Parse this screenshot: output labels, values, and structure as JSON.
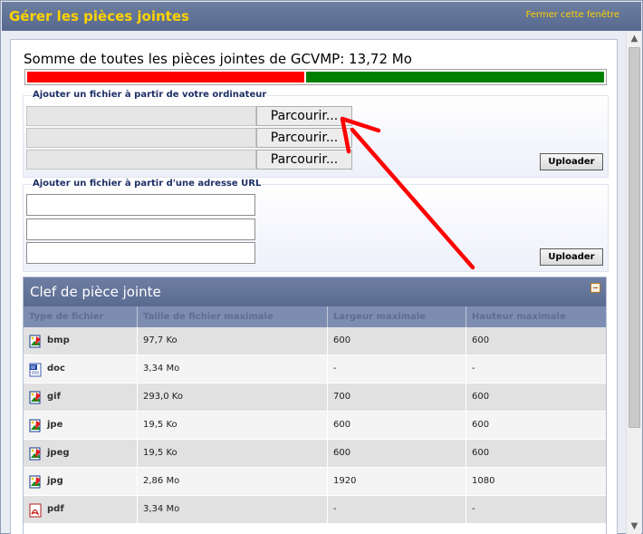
{
  "window": {
    "title": "Gérer les pièces jointes",
    "close_link": "Fermer cette fenêtre"
  },
  "quota": {
    "summary": "Somme de toutes les pièces jointes de GCVMP: 13,72 Mo",
    "colors": {
      "used": "#ff0000",
      "free": "#008000"
    }
  },
  "upload_computer": {
    "legend": "Ajouter un fichier à partir de votre ordinateur",
    "browse_labels": [
      "Parcourir...",
      "Parcourir...",
      "Parcourir..."
    ],
    "upload_label": "Uploader"
  },
  "upload_url": {
    "legend": "Ajouter un fichier à partir d'une adresse URL",
    "upload_label": "Uploader"
  },
  "key_table": {
    "title": "Clef de pièce jointe",
    "columns": [
      "Type de fichier",
      "Taille de fichier maximale",
      "Largeur maximale",
      "Hauteur maximale"
    ],
    "rows": [
      {
        "type": "bmp",
        "icon": "image-file-icon",
        "size": "97,7 Ko",
        "width": "600",
        "height": "600"
      },
      {
        "type": "doc",
        "icon": "word-document-icon",
        "size": "3,34 Mo",
        "width": "-",
        "height": "-"
      },
      {
        "type": "gif",
        "icon": "image-file-icon",
        "size": "293,0 Ko",
        "width": "700",
        "height": "600"
      },
      {
        "type": "jpe",
        "icon": "image-file-icon",
        "size": "19,5 Ko",
        "width": "600",
        "height": "600"
      },
      {
        "type": "jpeg",
        "icon": "image-file-icon",
        "size": "19,5 Ko",
        "width": "600",
        "height": "600"
      },
      {
        "type": "jpg",
        "icon": "image-file-icon",
        "size": "2,86 Mo",
        "width": "1920",
        "height": "1080"
      },
      {
        "type": "pdf",
        "icon": "pdf-file-icon",
        "size": "3,34 Mo",
        "width": "-",
        "height": "-"
      }
    ]
  },
  "colors": {
    "title_text": "#ffd200",
    "header_bg": "#5a6b91",
    "annotation_arrow": "#ff0000"
  }
}
